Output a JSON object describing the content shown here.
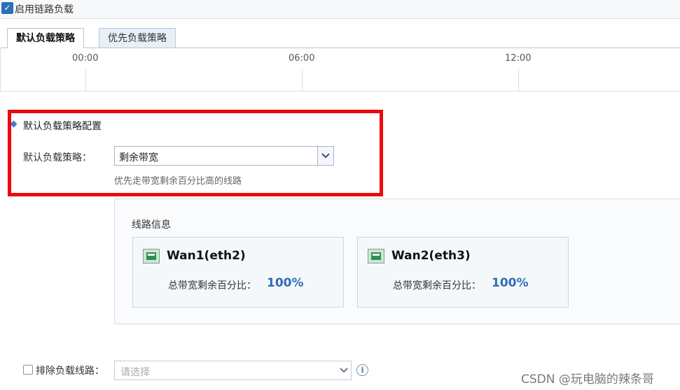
{
  "header": {
    "enable_label": "启用链路负载",
    "enable_checked": true
  },
  "tabs": [
    {
      "label": "默认负载策略",
      "active": true
    },
    {
      "label": "优先负载策略",
      "active": false
    }
  ],
  "timeline": {
    "ticks": [
      "00:00",
      "06:00",
      "12:00"
    ]
  },
  "config": {
    "section_title": "默认负载策略配置",
    "strategy_label": "默认负载策略：",
    "strategy_value": "剩余带宽",
    "strategy_hint": "优先走带宽剩余百分比高的线路"
  },
  "line_info": {
    "title": "线路信息",
    "lines": [
      {
        "name": "Wan1(eth2)",
        "ratio_label": "总带宽剩余百分比：",
        "ratio_value": "100%"
      },
      {
        "name": "Wan2(eth3)",
        "ratio_label": "总带宽剩余百分比：",
        "ratio_value": "100%"
      }
    ]
  },
  "exclude": {
    "label": "排除负载线路：",
    "placeholder": "请选择",
    "checked": false
  },
  "watermark": "CSDN @玩电脑的辣条哥",
  "colors": {
    "highlight": "#ec0a0a",
    "accent": "#2f6db7"
  }
}
